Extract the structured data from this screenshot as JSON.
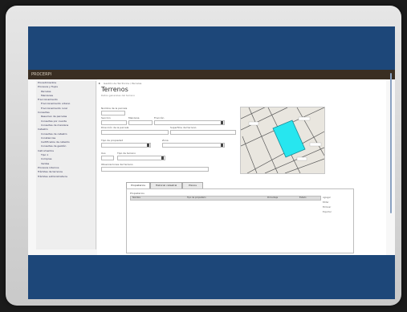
{
  "appbar": {
    "title": "PROCERPI"
  },
  "sidebar": {
    "items": [
      {
        "label": "Procedimientos"
      },
      {
        "label": "Procesos y flujos"
      },
      {
        "label": "Parcelas"
      },
      {
        "label": "Manzanas"
      },
      {
        "label": "Fraccionamiento"
      },
      {
        "label": "Fraccionamiento urbano"
      },
      {
        "label": "Fraccionamiento rural"
      },
      {
        "label": "Consultas"
      },
      {
        "label": "Resumen de parcelas"
      },
      {
        "label": "Consultas por cuenta"
      },
      {
        "label": "Consultas de manzana"
      },
      {
        "label": "Catastro"
      },
      {
        "label": "Consultas de catastro"
      },
      {
        "label": "Constancias"
      },
      {
        "label": "Certificados de catastro"
      },
      {
        "label": "Consultas de gestión"
      },
      {
        "label": "Instrumentos"
      },
      {
        "label": "Tipo 1"
      },
      {
        "label": "Compras"
      },
      {
        "label": "Ventas"
      },
      {
        "label": "Procesos internos"
      },
      {
        "label": "Trámites de terrenos"
      },
      {
        "label": "Trámites administrativos"
      }
    ]
  },
  "main": {
    "breadcrumb": "Gestión de Territorios / Parcelas",
    "title": "Terrenos",
    "subtitle": "Datos generales del terreno",
    "form": {
      "field1_label": "Nombre de la parcela",
      "field2_label": "Sección",
      "field3_label": "Manzana",
      "field4_label": "Fracción",
      "field5_label": "Dirección de la parcela",
      "field6_label": "Superficie del terreno",
      "field7_label": "Tipo de propiedad",
      "field8_label": "Zona",
      "field9_label": "Uso",
      "field10_label": "Tipo de terreno",
      "field11_label": "Observaciones del terreno"
    },
    "tabs": [
      {
        "label": "Propietarios"
      },
      {
        "label": "Historial catastral"
      },
      {
        "label": "Planos"
      }
    ],
    "panel": {
      "label": "Propietarios",
      "columns": [
        "Nombre",
        "Tipo de propietario",
        "Porcentaje",
        "Estado"
      ],
      "actions": [
        "Agregar",
        "Editar",
        "Eliminar",
        "Exportar"
      ]
    }
  },
  "colors": {
    "band": "#1d4779",
    "appbar": "#3a2e22",
    "parcel_highlight": "#27e6ef"
  }
}
